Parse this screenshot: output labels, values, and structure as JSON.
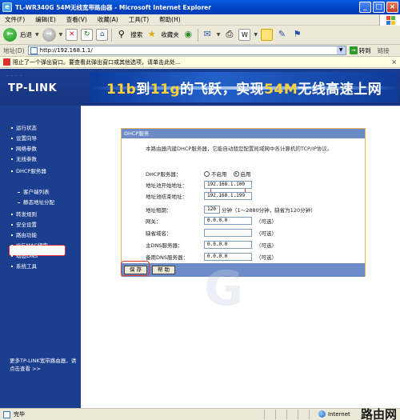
{
  "window": {
    "title": "TL-WR340G 54M无线宽带路由器 - Microsoft Internet Explorer",
    "controls": {
      "minimize": "_",
      "maximize": "□",
      "close": "×"
    }
  },
  "menu": [
    "文件(F)",
    "编辑(E)",
    "查看(V)",
    "收藏(A)",
    "工具(T)",
    "帮助(H)"
  ],
  "toolbar": {
    "back_label": "后退",
    "search_label": "搜索",
    "favorites_label": "收藏夹"
  },
  "address": {
    "label": "地址(D)",
    "url": "http://192.168.1.1/",
    "go_label": "转到",
    "links_label": "链接"
  },
  "infobar": {
    "text": "阻止了一个弹出窗口。要查看此弹出窗口或其他选项，请单击此处..."
  },
  "banner": {
    "brand": "TP-LINK",
    "slogan_a": "11b",
    "slogan_b": "到",
    "slogan_c": "11g",
    "slogan_d": "的飞跃，实现",
    "slogan_e": "54M",
    "slogan_f": "无线高速上网"
  },
  "nav": {
    "items": [
      {
        "label": "运行状态",
        "level": 1
      },
      {
        "label": "设置向导",
        "level": 1
      },
      {
        "label": "网络参数",
        "level": 1
      },
      {
        "label": "无线参数",
        "level": 1
      },
      {
        "label": "DHCP服务器",
        "level": 1
      },
      {
        "label": "DHCP服务",
        "level": 2,
        "active": true
      },
      {
        "label": "客户端列表",
        "level": 2
      },
      {
        "label": "静态地址分配",
        "level": 2
      },
      {
        "label": "转发规则",
        "level": 1
      },
      {
        "label": "安全设置",
        "level": 1
      },
      {
        "label": "路由功能",
        "level": 1
      },
      {
        "label": "IP与MAC绑定",
        "level": 1
      },
      {
        "label": "动态DNS",
        "level": 1
      },
      {
        "label": "系统工具",
        "level": 1
      }
    ],
    "more_text": "更多TP-LINK宽带路由器，请点击查看 >>"
  },
  "dhcp": {
    "panel_title": "DHCP服务",
    "description": "本路由器内建DHCP服务器，它能自动替您配置局域网中各计算机的TCP/IP协议。",
    "server_label": "DHCP服务器：",
    "disable_label": "不启用",
    "enable_label": "启用",
    "enabled": true,
    "start_label": "地址池开始地址：",
    "start_value": "192.168.1.100",
    "end_label": "地址池结束地址：",
    "end_value": "192.168.1.199",
    "lease_label": "地址租期：",
    "lease_value": "120",
    "lease_hint": "分钟（1～2880分钟，缺省为120分钟）",
    "gateway_label": "网关：",
    "gateway_value": "0.0.0.0",
    "gateway_hint": "（可选）",
    "domain_label": "缺省域名：",
    "domain_value": "",
    "domain_hint": "（可选）",
    "dns1_label": "主DNS服务器：",
    "dns1_value": "0.0.0.0",
    "dns1_hint": "（可选）",
    "dns2_label": "备用DNS服务器：",
    "dns2_value": "0.0.0.0",
    "dns2_hint": "（可选）",
    "save_label": "保 存",
    "help_label": "帮 助"
  },
  "status": {
    "left": "完毕",
    "zone": "Internet",
    "site_mark": "路由网"
  }
}
